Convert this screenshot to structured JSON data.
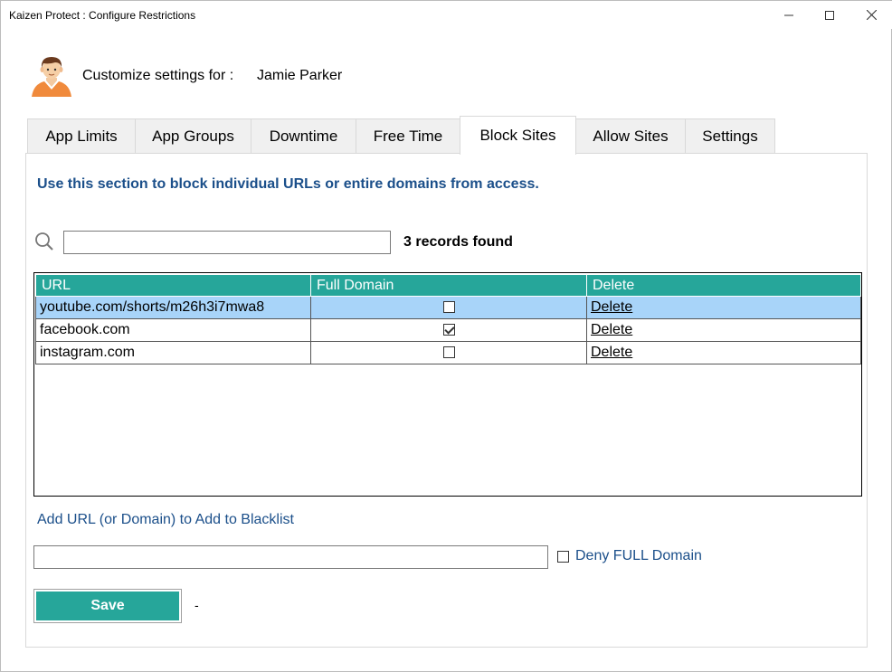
{
  "window": {
    "title": "Kaizen Protect : Configure Restrictions",
    "minimize_icon": "minimize-icon",
    "maximize_icon": "maximize-icon",
    "close_icon": "close-icon"
  },
  "header": {
    "avatar_icon": "user-avatar",
    "customize_label": "Customize settings for :",
    "user_name": "Jamie Parker"
  },
  "tabs": [
    {
      "label": "App Limits",
      "active": false
    },
    {
      "label": "App Groups",
      "active": false
    },
    {
      "label": "Downtime",
      "active": false
    },
    {
      "label": "Free Time",
      "active": false
    },
    {
      "label": "Block Sites",
      "active": true
    },
    {
      "label": "Allow Sites",
      "active": false
    },
    {
      "label": "Settings",
      "active": false
    }
  ],
  "block_sites": {
    "description": "Use this section to block individual URLs or entire domains from access.",
    "search": {
      "value": "",
      "placeholder": "",
      "icon": "search-icon"
    },
    "records_found": "3 records found",
    "table": {
      "columns": [
        "URL",
        "Full Domain",
        "Delete"
      ],
      "rows": [
        {
          "url": "youtube.com/shorts/m26h3i7mwa8",
          "full_domain": false,
          "delete": "Delete",
          "selected": true
        },
        {
          "url": "facebook.com",
          "full_domain": true,
          "delete": "Delete",
          "selected": false
        },
        {
          "url": "instagram.com",
          "full_domain": false,
          "delete": "Delete",
          "selected": false
        }
      ]
    },
    "add_label": "Add URL (or Domain) to Add to Blacklist",
    "add_input": {
      "value": "",
      "placeholder": ""
    },
    "deny_full_domain": {
      "label": "Deny FULL Domain",
      "checked": false
    },
    "save_label": "Save",
    "status_text": "-"
  },
  "colors": {
    "accent": "#26a69a",
    "link_blue": "#1b4f8a",
    "selected_row": "#a8d4f9"
  }
}
